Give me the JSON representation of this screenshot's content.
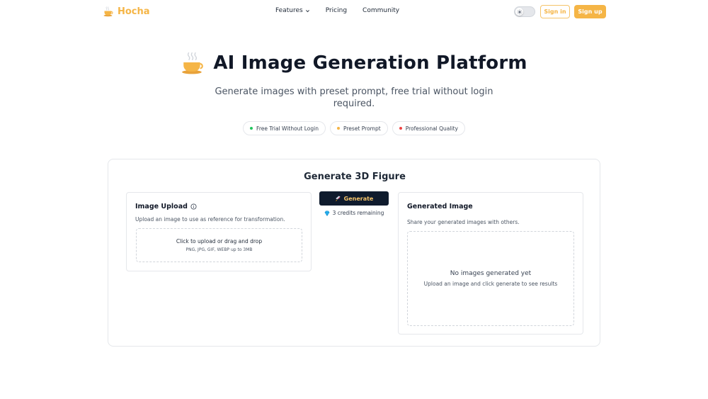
{
  "header": {
    "brand": "Hocha",
    "nav": [
      {
        "label": "Features",
        "icon": "chevron-down-icon"
      },
      {
        "label": "Pricing"
      },
      {
        "label": "Community"
      }
    ],
    "sign_in": "Sign in",
    "sign_up": "Sign up"
  },
  "hero": {
    "icon": "coffee-cup-icon",
    "title": "AI Image Generation Platform",
    "subtitle": "Generate images with preset prompt, free trial without login required.",
    "badges": [
      {
        "label": "Free Trial Without Login",
        "color": "#22c55e"
      },
      {
        "label": "Preset Prompt",
        "color": "#f5b546"
      },
      {
        "label": "Professional Quality",
        "color": "#ef4444"
      }
    ]
  },
  "generator": {
    "title": "Generate 3D Figure",
    "upload": {
      "title": "Image Upload",
      "description": "Upload an image to use as reference for transformation.",
      "drop_main": "Click to upload or drag and drop",
      "drop_sub": "PNG, JPG, GIF, WEBP up to 3MB"
    },
    "generate_button": "Generate",
    "credits": "3 credits remaining",
    "output": {
      "title": "Generated Image",
      "description": "Share your generated images with others.",
      "empty_title": "No images generated yet",
      "empty_sub": "Upload an image and click generate to see results"
    }
  },
  "colors": {
    "accent": "#f5b546",
    "dark_button": "#0f1b2d"
  }
}
